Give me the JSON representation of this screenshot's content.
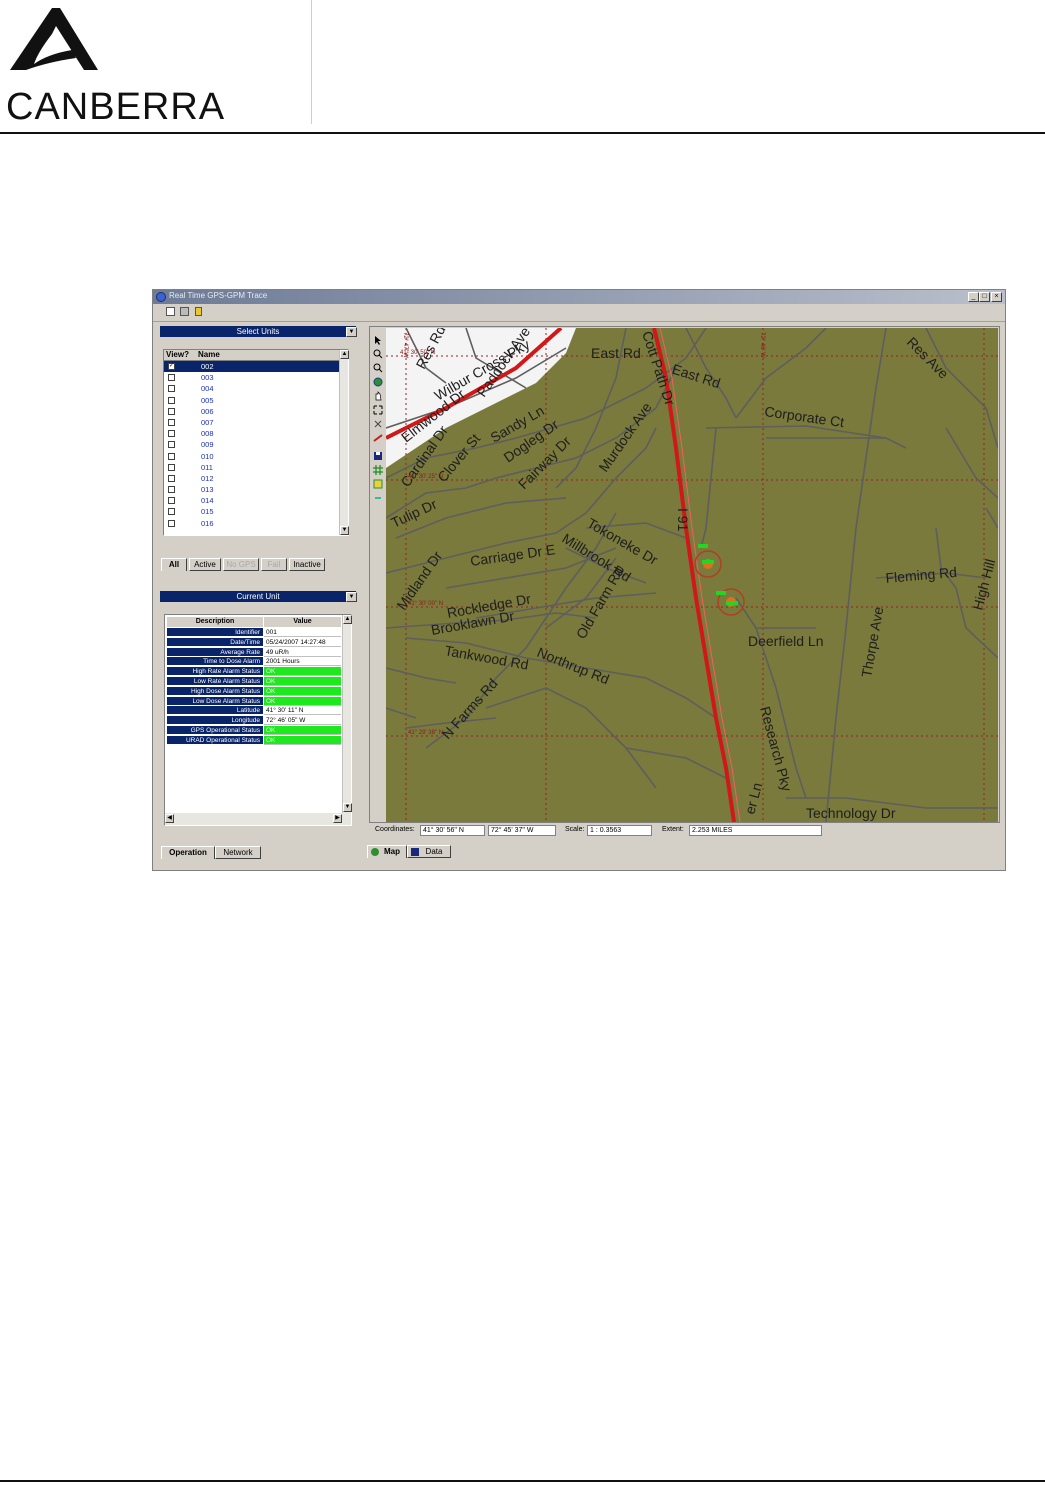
{
  "header": {
    "brand": "CANBERRA"
  },
  "window": {
    "title": "Real Time GPS-GPM Trace",
    "controls": {
      "minimize": "_",
      "maximize": "□",
      "close": "×"
    }
  },
  "select_units": {
    "title": "Select Units",
    "columns": [
      "View?",
      "Name"
    ],
    "units": [
      {
        "name": "002",
        "checked": true
      },
      {
        "name": "003"
      },
      {
        "name": "004"
      },
      {
        "name": "005"
      },
      {
        "name": "006"
      },
      {
        "name": "007"
      },
      {
        "name": "008"
      },
      {
        "name": "009"
      },
      {
        "name": "010"
      },
      {
        "name": "011"
      },
      {
        "name": "012"
      },
      {
        "name": "013"
      },
      {
        "name": "014"
      },
      {
        "name": "015"
      },
      {
        "name": "016"
      }
    ],
    "filter_tabs": [
      "All",
      "Active",
      "No GPS",
      "Fail",
      "Inactive"
    ]
  },
  "current_unit": {
    "title": "Current Unit",
    "columns": [
      "Description",
      "Value"
    ],
    "rows": [
      {
        "desc": "Identifier",
        "value": "001",
        "ok": false
      },
      {
        "desc": "Date/Time",
        "value": "05/24/2007 14:27:48",
        "ok": false
      },
      {
        "desc": "Average Rate",
        "value": "49 uR/h",
        "ok": false
      },
      {
        "desc": "Time to Dose Alarm",
        "value": "2001 Hours",
        "ok": false
      },
      {
        "desc": "High Rate Alarm Status",
        "value": "OK",
        "ok": true
      },
      {
        "desc": "Low Rate Alarm Status",
        "value": "OK",
        "ok": true
      },
      {
        "desc": "High Dose Alarm Status",
        "value": "OK",
        "ok": true
      },
      {
        "desc": "Low Dose Alarm Status",
        "value": "OK",
        "ok": true
      },
      {
        "desc": "Latitude",
        "value": "41° 30' 11\" N",
        "ok": false
      },
      {
        "desc": "Longitude",
        "value": "72° 46' 05\" W",
        "ok": false
      },
      {
        "desc": "GPS Operational Status",
        "value": "OK",
        "ok": true
      },
      {
        "desc": "URAD Operational Status",
        "value": "OK",
        "ok": true
      }
    ]
  },
  "bottom_tabs_left": [
    "Operation",
    "Network"
  ],
  "bottom_tabs_right": [
    "Map",
    "Data"
  ],
  "map": {
    "streets": [
      "Res Rd",
      "Wilbur Cross Pky",
      "Paddock Ave",
      "Elmwood Dr",
      "East Rd",
      "East Rd",
      "Cott Path Dr",
      "Res Ave",
      "Corporate Ct",
      "Cardinal Dr",
      "Clover St",
      "Sandy Ln",
      "Dogleg Dr",
      "Fairway Dr",
      "Murdock Ave",
      "Tulip Dr",
      "I 91",
      "Tokoneke Dr",
      "Carriage Dr E",
      "Millbrook Rd",
      "Old Farm Rd",
      "Fleming Rd",
      "High Hill",
      "Midland Dr",
      "Rockledge Dr",
      "Brooklawn Dr",
      "Deerfield Ln",
      "Tankwood Rd",
      "Northrup Rd",
      "Thorpe Ave",
      "N Farms Rd",
      "Research Pky",
      "Technology Dr",
      "er Ln"
    ],
    "grid_labels": [
      "41° 30' 50\" N",
      "41° 30' 25\" N",
      "41° 30' 00\" N",
      "41° 29' 38\" N",
      "72° 47' W",
      "72° 46' W"
    ],
    "colors": {
      "land": "#7a7a3c",
      "highway": "#d01818",
      "road": "#5e5e5e",
      "grid": "#9a1f1f",
      "residential": "#f4f4f4",
      "marker": "#22d622"
    }
  },
  "status": {
    "coord_label": "Coordinates:",
    "lat": "41° 30' 56\" N",
    "lon": "72° 45' 37\" W",
    "scale_label": "Scale:",
    "scale": "1 : 0.3563",
    "extent_label": "Extent:",
    "extent": "2.253 MILES"
  }
}
